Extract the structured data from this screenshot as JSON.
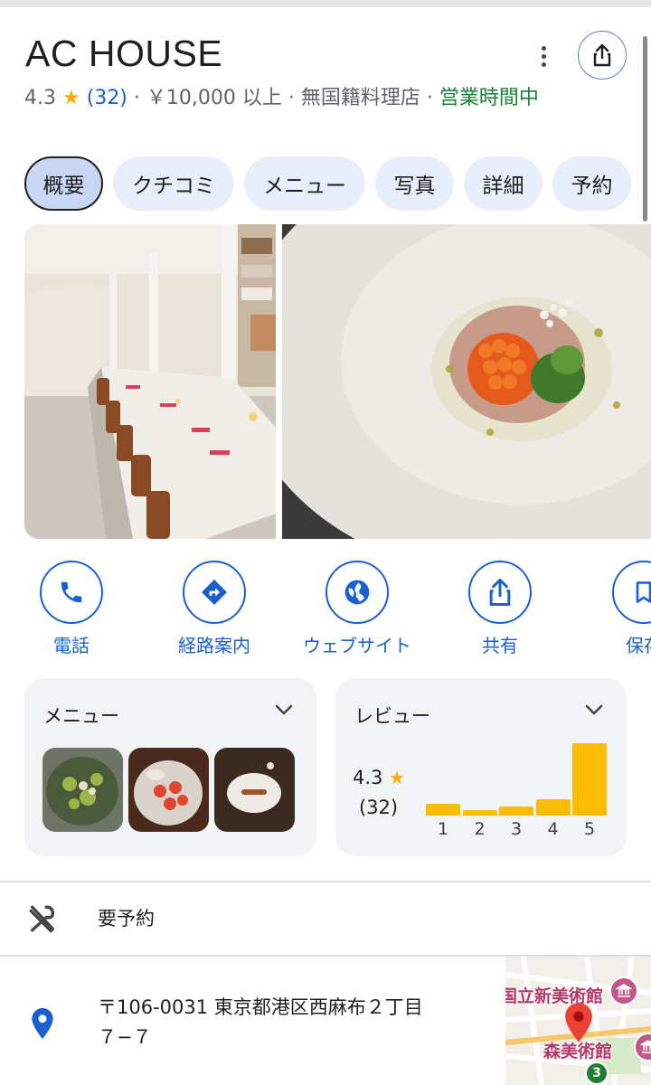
{
  "place": {
    "name": "AC HOUSE",
    "rating": "4.3",
    "star": "★",
    "review_count": "(32)",
    "sep": "·",
    "price": "￥10,000 以上",
    "category": "無国籍料理店",
    "status": "営業時間中"
  },
  "tabs": [
    {
      "label": "概要",
      "active": true
    },
    {
      "label": "クチコミ"
    },
    {
      "label": "メニュー"
    },
    {
      "label": "写真"
    },
    {
      "label": "詳細"
    },
    {
      "label": "予約"
    }
  ],
  "actions": [
    {
      "label": "電話",
      "icon": "phone-icon"
    },
    {
      "label": "経路案内",
      "icon": "directions-icon"
    },
    {
      "label": "ウェブサイト",
      "icon": "globe-icon"
    },
    {
      "label": "共有",
      "icon": "share-icon"
    },
    {
      "label": "保存",
      "icon": "bookmark-icon"
    }
  ],
  "menu_card": {
    "title": "メニュー"
  },
  "review_card": {
    "title": "レビュー",
    "score": "4.3",
    "star": "★",
    "count": "(32)",
    "distribution": [
      {
        "label": "1",
        "share": 0.16
      },
      {
        "label": "2",
        "share": 0.08
      },
      {
        "label": "3",
        "share": 0.12
      },
      {
        "label": "4",
        "share": 0.22
      },
      {
        "label": "5",
        "share": 1.0
      }
    ]
  },
  "reservation": {
    "text": "要予約",
    "icon": "utensils-icon"
  },
  "address": {
    "line1": "〒106-0031 東京都港区西麻布２丁目",
    "line2": "７−７",
    "icon": "location-pin-icon"
  },
  "map": {
    "label_top": "国立新美術館",
    "label_bottom": "森美術館",
    "route_number": "3"
  },
  "colors": {
    "accent": "#1a5fd0",
    "open_green": "#188038",
    "star": "#f9ab00",
    "bar": "#fbbc04",
    "chip_bg": "#e8eefb",
    "card_bg": "#f1f3f4"
  }
}
